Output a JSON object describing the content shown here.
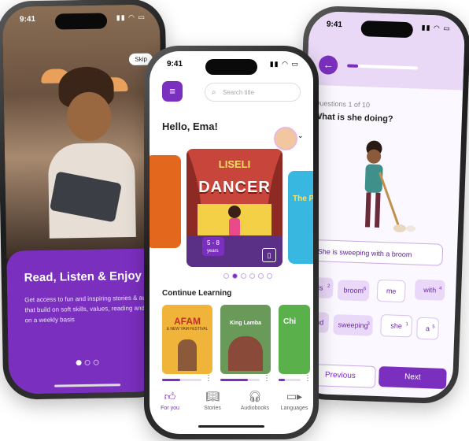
{
  "left_phone": {
    "time": "9:41",
    "skip_label": "Skip",
    "title": "Read, Listen & Enjoy",
    "body": "Get access to fun and inspiring stories & audiobooks that build on soft skills, values, reading and numeracy on a weekly basis",
    "pager_active_index": 0
  },
  "center_phone": {
    "time": "9:41",
    "search_placeholder": "Search title",
    "greeting": "Hello, Ema!",
    "featured_book": {
      "title_top": "LISELI",
      "title_bottom": "DANCER",
      "age_badge": "5 - 8",
      "age_unit": "years"
    },
    "side_book_right_label": "The P",
    "carousel_active_index": 1,
    "section_title": "Continue Learning",
    "continue_items": [
      {
        "title": "AFAM",
        "subtitle": "& NEW YAM FESTIVAL",
        "progress": 0.45
      },
      {
        "title": "King Lamba",
        "progress": 0.7
      },
      {
        "title": "Chi",
        "progress": 0.3
      }
    ],
    "tabs": [
      {
        "label": "For you",
        "icon": "thumbs-up-icon"
      },
      {
        "label": "Stories",
        "icon": "book-icon"
      },
      {
        "label": "Audiobooks",
        "icon": "headphones-icon"
      },
      {
        "label": "Languages",
        "icon": "video-icon"
      }
    ],
    "active_tab_index": 0
  },
  "right_phone": {
    "time": "9:41",
    "progress": 0.15,
    "question_count": "Questions 1 of 10",
    "question": "What is she doing?",
    "answer": "She is sweeping with a broom",
    "words": [
      {
        "text": "is",
        "order": "2",
        "state": "used"
      },
      {
        "text": "broom",
        "order": "6",
        "state": "used"
      },
      {
        "text": "me",
        "order": "",
        "state": "free"
      },
      {
        "text": "with",
        "order": "4",
        "state": "used"
      },
      {
        "text": "and",
        "order": "",
        "state": "used"
      },
      {
        "text": "sweeping",
        "order": "3",
        "state": "used"
      },
      {
        "text": "she",
        "order": "1",
        "state": "free"
      },
      {
        "text": "a",
        "order": "5",
        "state": "free"
      }
    ],
    "previous_label": "Previous",
    "next_label": "Next"
  },
  "colors": {
    "brand_purple": "#7b2fbf",
    "light_purple": "#e9d9f7"
  }
}
